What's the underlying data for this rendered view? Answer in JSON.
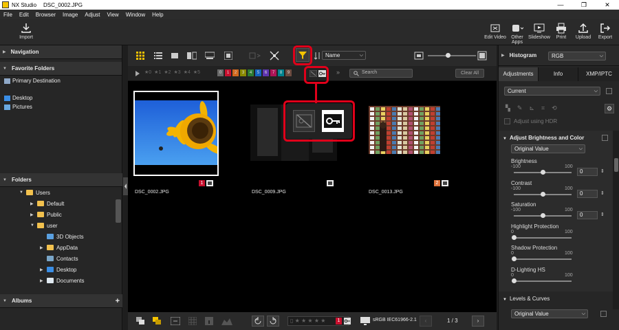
{
  "window": {
    "app_name": "NX Studio",
    "file_name": "DSC_0002.JPG",
    "minimize": "—",
    "maximize": "❐",
    "close": "✕"
  },
  "menu": [
    "File",
    "Edit",
    "Browser",
    "Image",
    "Adjust",
    "View",
    "Window",
    "Help"
  ],
  "toolbar": {
    "import_label": "Import",
    "right_buttons": [
      "Edit Video",
      "Other Apps",
      "Slideshow",
      "Print",
      "Upload",
      "Export"
    ]
  },
  "left_panel": {
    "navigation": "Navigation",
    "favorite_folders": "Favorite Folders",
    "primary_destination": "Primary Destination",
    "favorites": [
      "Desktop",
      "Pictures"
    ],
    "folders": "Folders",
    "tree": [
      {
        "label": "Users",
        "indent": 1,
        "arrow": "▼"
      },
      {
        "label": "Default",
        "indent": 2,
        "arrow": "▶"
      },
      {
        "label": "Public",
        "indent": 2,
        "arrow": "▶"
      },
      {
        "label": "user",
        "indent": 2,
        "arrow": "▼"
      },
      {
        "label": "3D Objects",
        "indent": 3,
        "arrow": ""
      },
      {
        "label": "AppData",
        "indent": 3,
        "arrow": "▶"
      },
      {
        "label": "Contacts",
        "indent": 3,
        "arrow": ""
      },
      {
        "label": "Desktop",
        "indent": 3,
        "arrow": "▶"
      },
      {
        "label": "Documents",
        "indent": 3,
        "arrow": "▶"
      }
    ],
    "albums": "Albums",
    "albums_add": "+"
  },
  "center": {
    "sort_label": "Name",
    "search_placeholder": "Search",
    "clear_all": "Clear All",
    "ratings": [
      "★0",
      "★1",
      "★2",
      "★3",
      "★4",
      "★5"
    ],
    "labels": [
      "0",
      "1",
      "2",
      "3",
      "4",
      "5",
      "6",
      "7",
      "8",
      "9"
    ],
    "label_colors": [
      "#6a6a6a",
      "#c8102e",
      "#d2691e",
      "#8a8a00",
      "#2e7d32",
      "#1565c0",
      "#5e35b1",
      "#ad1457",
      "#00838f",
      "#6d4c41"
    ],
    "thumbnails": [
      {
        "name": "DSC_0002.JPG",
        "badge": "1",
        "badge_color": "#c8102e"
      },
      {
        "name": "DSC_0009.JPG",
        "badge": "",
        "badge_color": ""
      },
      {
        "name": "DSC_0013.JPG",
        "badge": "2",
        "badge_color": "#e0733b"
      }
    ],
    "color_profile": "sRGB IEC61966-2.1",
    "page": "1 / 3",
    "bottom_badge": "1"
  },
  "right_panel": {
    "histogram": "Histogram",
    "histogram_mode": "RGB",
    "tabs": [
      "Adjustments",
      "Info",
      "XMP/IPTC"
    ],
    "preset": "Current",
    "adjust_hdr": "Adjust using HDR",
    "section_brightness": "Adjust Brightness and Color",
    "original_value": "Original Value",
    "sliders": [
      {
        "label": "Brightness",
        "min": "-100",
        "max": "100",
        "value": "0",
        "pos": 0.5
      },
      {
        "label": "Contrast",
        "min": "-100",
        "max": "100",
        "value": "0",
        "pos": 0.5
      },
      {
        "label": "Saturation",
        "min": "-100",
        "max": "100",
        "value": "0",
        "pos": 0.5
      },
      {
        "label": "Highlight Protection",
        "min": "0",
        "max": "100",
        "value": "0",
        "pos": 0.0
      },
      {
        "label": "Shadow Protection",
        "min": "0",
        "max": "100",
        "value": "0",
        "pos": 0.0
      },
      {
        "label": "D-Lighting HS",
        "min": "0",
        "max": "100",
        "value": "0",
        "pos": 0.0
      }
    ],
    "section_levels": "Levels & Curves",
    "levels_value": "Original Value"
  }
}
